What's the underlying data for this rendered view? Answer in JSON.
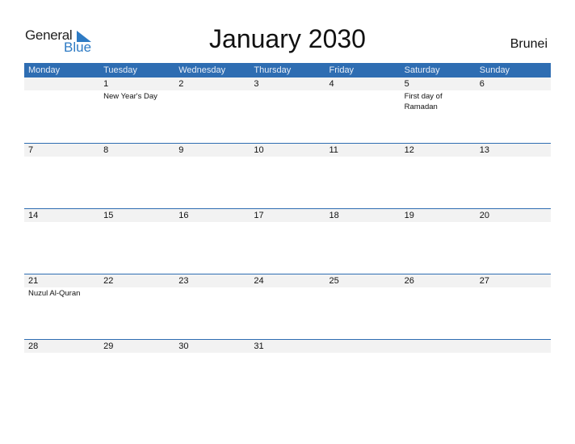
{
  "logo": {
    "general": "General",
    "blue": "Blue"
  },
  "title": "January 2030",
  "country": "Brunei",
  "colors": {
    "header_bg": "#2e6db2",
    "accent": "#2e7bc4",
    "day_row_bg": "#f2f2f2"
  },
  "weekdays": [
    "Monday",
    "Tuesday",
    "Wednesday",
    "Thursday",
    "Friday",
    "Saturday",
    "Sunday"
  ],
  "weeks": [
    {
      "days": [
        "",
        "1",
        "2",
        "3",
        "4",
        "5",
        "6"
      ],
      "events": [
        "",
        "New Year's Day",
        "",
        "",
        "",
        "First day of Ramadan",
        ""
      ]
    },
    {
      "days": [
        "7",
        "8",
        "9",
        "10",
        "11",
        "12",
        "13"
      ],
      "events": [
        "",
        "",
        "",
        "",
        "",
        "",
        ""
      ]
    },
    {
      "days": [
        "14",
        "15",
        "16",
        "17",
        "18",
        "19",
        "20"
      ],
      "events": [
        "",
        "",
        "",
        "",
        "",
        "",
        ""
      ]
    },
    {
      "days": [
        "21",
        "22",
        "23",
        "24",
        "25",
        "26",
        "27"
      ],
      "events": [
        "Nuzul Al-Quran",
        "",
        "",
        "",
        "",
        "",
        ""
      ]
    },
    {
      "days": [
        "28",
        "29",
        "30",
        "31",
        "",
        "",
        ""
      ],
      "events": [
        "",
        "",
        "",
        "",
        "",
        "",
        ""
      ]
    }
  ]
}
